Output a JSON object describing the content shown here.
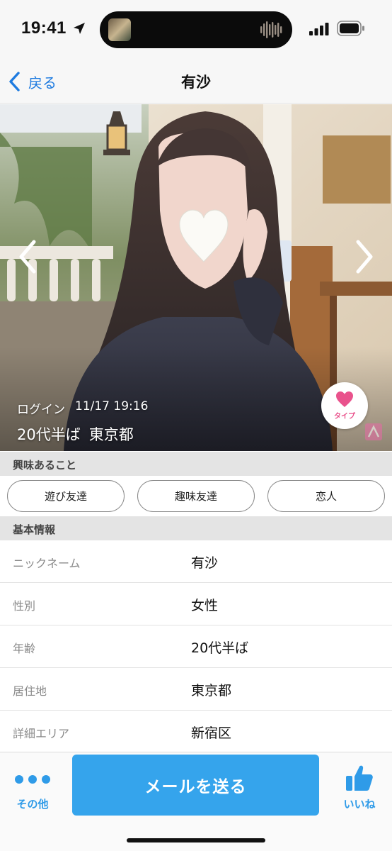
{
  "status_bar": {
    "time": "19:41"
  },
  "nav": {
    "back_label": "戻る",
    "title": "有沙"
  },
  "photo": {
    "login_label": "ログイン",
    "login_time": "11/17 19:16",
    "age": "20代半ば",
    "location": "東京都",
    "type_label": "タイプ"
  },
  "interests": {
    "header": "興味あること",
    "items": [
      "遊び友達",
      "趣味友達",
      "恋人"
    ]
  },
  "basic_info": {
    "header": "基本情報",
    "rows": [
      {
        "key": "ニックネーム",
        "value": "有沙"
      },
      {
        "key": "性別",
        "value": "女性"
      },
      {
        "key": "年齢",
        "value": "20代半ば"
      },
      {
        "key": "居住地",
        "value": "東京都"
      },
      {
        "key": "詳細エリア",
        "value": "新宿区"
      }
    ]
  },
  "bottom_bar": {
    "more_label": "その他",
    "mail_label": "メールを送る",
    "like_label": "いいね"
  },
  "colors": {
    "accent_blue": "#35a4ec",
    "link_blue": "#1e7be0",
    "heart_pink": "#e9528c"
  },
  "icons": [
    "location-icon",
    "signal-icon",
    "battery-icon",
    "chevron-left-icon",
    "chevron-right-icon",
    "heart-icon",
    "more-dots-icon",
    "thumbs-up-icon"
  ]
}
